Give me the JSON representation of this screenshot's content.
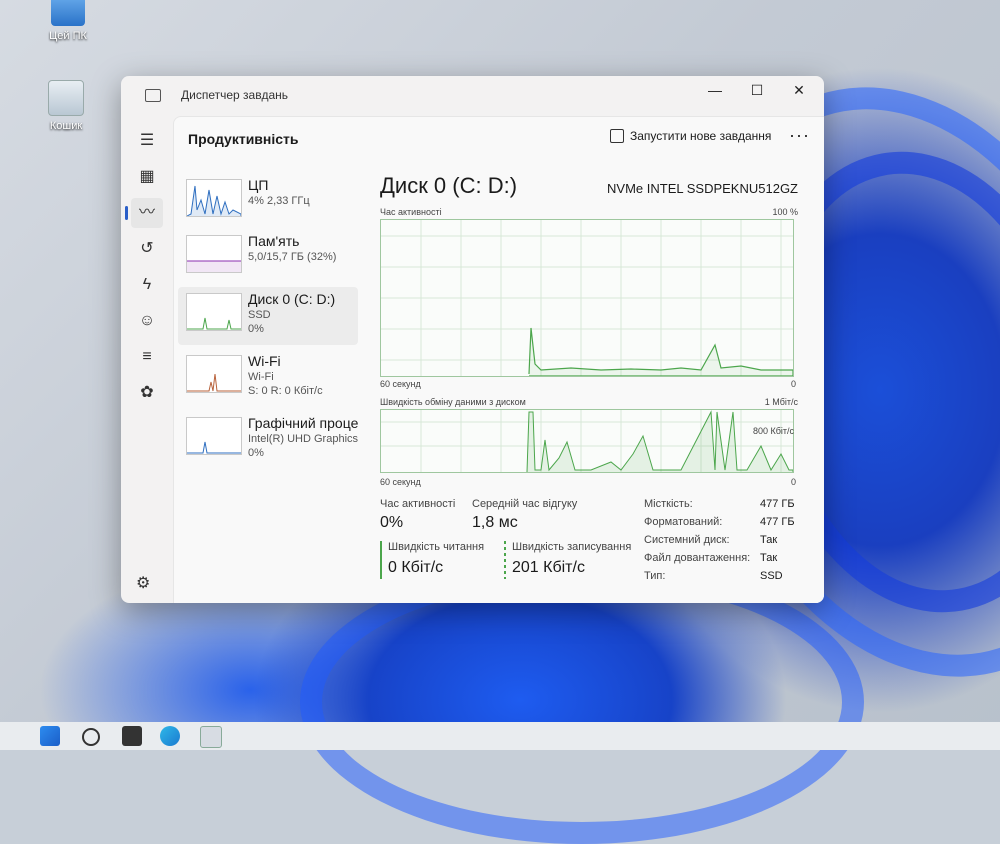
{
  "desktop": {
    "icons": [
      {
        "label": "Цей ПК"
      },
      {
        "label": "Кошик"
      }
    ]
  },
  "window": {
    "title": "Диспетчер завдань",
    "controls": {
      "minimize": "—",
      "maximize": "☐",
      "close": "✕"
    }
  },
  "header": {
    "page_title": "Продуктивність",
    "run_task_label": "Запустити нове завдання",
    "more_label": "···"
  },
  "perf_items": [
    {
      "name": "ЦП",
      "sub1": "4% 2,33 ГГц",
      "sub2": ""
    },
    {
      "name": "Пам'ять",
      "sub1": "5,0/15,7 ГБ (32%)",
      "sub2": ""
    },
    {
      "name": "Диск 0 (C: D:)",
      "sub1": "SSD",
      "sub2": "0%"
    },
    {
      "name": "Wi-Fi",
      "sub1": "Wi-Fi",
      "sub2": "S: 0 R: 0 Кбіт/с"
    },
    {
      "name": "Графічний проце",
      "sub1": "Intel(R) UHD Graphics",
      "sub2": "0%"
    }
  ],
  "detail": {
    "title": "Диск 0 (C: D:)",
    "model": "NVMe INTEL SSDPEKNU512GZ",
    "graph1": {
      "label": "Час активності",
      "max": "100 %",
      "time": "60 секунд",
      "min": "0"
    },
    "graph2": {
      "label": "Швидкість обміну даними з диском",
      "max": "1 Мбіт/с",
      "mid": "800 Кбіт/с",
      "time": "60 секунд",
      "min": "0"
    },
    "stats": {
      "active_label": "Час активності",
      "active_value": "0%",
      "resp_label": "Середній час відгуку",
      "resp_value": "1,8 мс",
      "read_label": "Швидкість читання",
      "read_value": "0 Кбіт/с",
      "write_label": "Швидкість записування",
      "write_value": "201 Кбіт/с"
    },
    "props": [
      {
        "label": "Місткість:",
        "value": "477 ГБ"
      },
      {
        "label": "Форматований:",
        "value": "477 ГБ"
      },
      {
        "label": "Системний диск:",
        "value": "Так"
      },
      {
        "label": "Файл довантаження:",
        "value": "Так"
      },
      {
        "label": "Тип:",
        "value": "SSD"
      }
    ]
  },
  "colors": {
    "accent": "#2b5fc8",
    "disk_line": "#4ca64c",
    "cpu_line": "#2f6fc0",
    "mem_line": "#8a2fb0",
    "wifi_line": "#b8613a"
  }
}
